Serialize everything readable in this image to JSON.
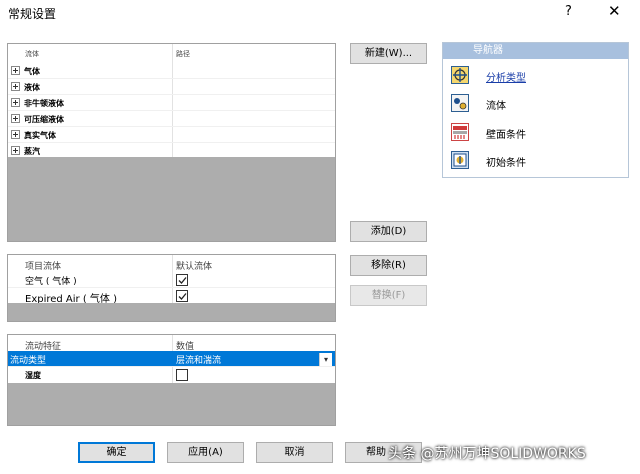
{
  "window": {
    "title": "常规设置",
    "help": "?",
    "close": "✕"
  },
  "fluids_panel": {
    "headers": {
      "col1": "流体",
      "col2": "路径"
    },
    "rows": [
      {
        "label": "气体"
      },
      {
        "label": "液体"
      },
      {
        "label": "非牛顿液体"
      },
      {
        "label": "可压缩液体"
      },
      {
        "label": "真实气体"
      },
      {
        "label": "蒸汽"
      }
    ]
  },
  "project_fluids_panel": {
    "headers": {
      "col1": "项目流体",
      "col2": "默认流体"
    },
    "rows": [
      {
        "label": "空气 ( 气体 )",
        "checked": true
      },
      {
        "label": "Expired Air ( 气体 )",
        "checked": true
      }
    ]
  },
  "flow_panel": {
    "headers": {
      "col1": "流动特征",
      "col2": "数值"
    },
    "rows": [
      {
        "label": "流动类型",
        "value": "层流和湍流",
        "selected": true
      },
      {
        "label": "湿度",
        "checked": false
      }
    ]
  },
  "buttons": {
    "new": "新建(W)...",
    "add": "添加(D)",
    "remove": "移除(R)",
    "replace": "替换(F)",
    "ok": "确定",
    "apply": "应用(A)",
    "cancel": "取消",
    "help": "帮助"
  },
  "navigator": {
    "title": "导航器",
    "items": [
      {
        "label": "分析类型",
        "icon": "analysis-type-icon",
        "selected": true
      },
      {
        "label": "流体",
        "icon": "fluid-icon"
      },
      {
        "label": "壁面条件",
        "icon": "wall-conditions-icon"
      },
      {
        "label": "初始条件",
        "icon": "initial-conditions-icon"
      }
    ]
  },
  "watermark": "头条 @苏州万坤SOLIDWORKS",
  "colors": {
    "accent": "#0078d7",
    "panel_gray": "#adadad",
    "nav_header": "#a8c0de"
  }
}
